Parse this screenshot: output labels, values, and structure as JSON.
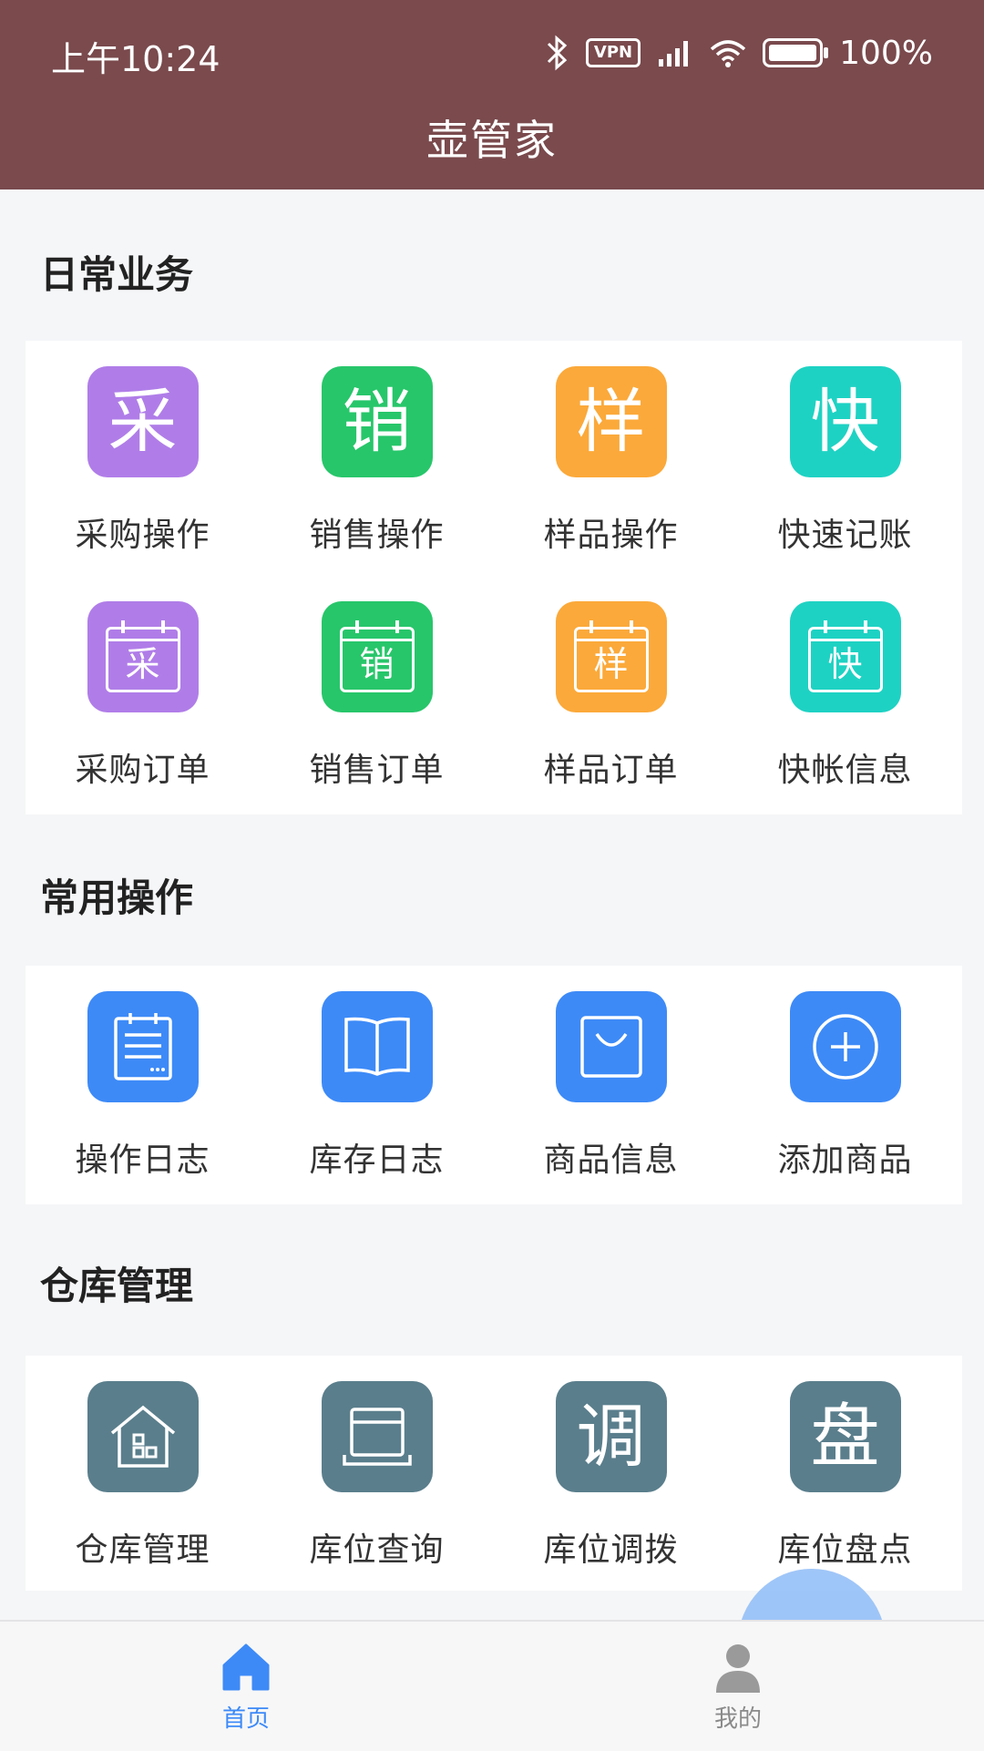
{
  "status_bar": {
    "time": "上午10:24",
    "vpn": "VPN",
    "battery": "100%"
  },
  "header": {
    "title": "壶管家"
  },
  "sections": [
    {
      "title": "日常业务",
      "items": [
        {
          "label": "采购操作",
          "glyph": "采",
          "color": "#b07de8"
        },
        {
          "label": "销售操作",
          "glyph": "销",
          "color": "#27c66a"
        },
        {
          "label": "样品操作",
          "glyph": "样",
          "color": "#fba93a"
        },
        {
          "label": "快速记账",
          "glyph": "快",
          "color": "#1ed2c3"
        },
        {
          "label": "采购订单",
          "glyph": "采",
          "color": "#b07de8"
        },
        {
          "label": "销售订单",
          "glyph": "销",
          "color": "#27c66a"
        },
        {
          "label": "样品订单",
          "glyph": "样",
          "color": "#fba93a"
        },
        {
          "label": "快帐信息",
          "glyph": "快",
          "color": "#1ed2c3"
        }
      ]
    },
    {
      "title": "常用操作",
      "items": [
        {
          "label": "操作日志",
          "icon": "log-icon",
          "color": "#3d8af7"
        },
        {
          "label": "库存日志",
          "icon": "book-icon",
          "color": "#3d8af7"
        },
        {
          "label": "商品信息",
          "icon": "bag-icon",
          "color": "#3d8af7"
        },
        {
          "label": "添加商品",
          "icon": "plus-circle-icon",
          "color": "#3d8af7"
        }
      ]
    },
    {
      "title": "仓库管理",
      "items": [
        {
          "label": "仓库管理",
          "icon": "warehouse-icon",
          "color": "#5a7e8c"
        },
        {
          "label": "库位查询",
          "icon": "box-icon",
          "color": "#5a7e8c"
        },
        {
          "label": "库位调拨",
          "glyph": "调",
          "color": "#5a7e8c"
        },
        {
          "label": "库位盘点",
          "glyph": "盘",
          "color": "#5a7e8c"
        }
      ]
    }
  ],
  "tabbar": {
    "items": [
      {
        "label": "首页",
        "icon": "home-icon",
        "active": true,
        "color": "#3d8af7"
      },
      {
        "label": "我的",
        "icon": "user-icon",
        "active": false,
        "color": "#9a9a9a"
      }
    ]
  }
}
